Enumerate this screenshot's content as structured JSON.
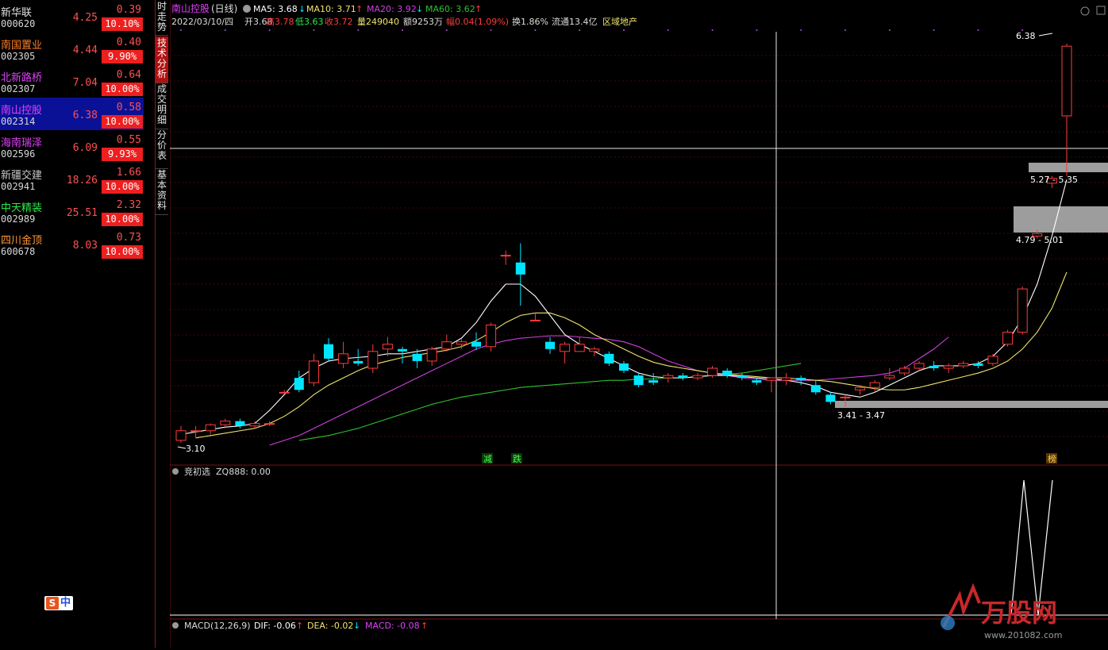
{
  "watchlist": [
    {
      "name": "新华联",
      "code": "000620",
      "price": "4.25",
      "change": "0.39",
      "pct": "10.10%",
      "name_color": "#e0e0e0"
    },
    {
      "name": "南国置业",
      "code": "002305",
      "price": "4.44",
      "change": "0.40",
      "pct": "9.90%",
      "name_color": "#ff7f27"
    },
    {
      "name": "北新路桥",
      "code": "002307",
      "price": "7.04",
      "change": "0.64",
      "pct": "10.00%",
      "name_color": "#e040fb"
    },
    {
      "name": "南山控股",
      "code": "002314",
      "price": "6.38",
      "change": "0.58",
      "pct": "10.00%",
      "name_color": "#e040fb",
      "selected": true
    },
    {
      "name": "海南瑞泽",
      "code": "002596",
      "price": "6.09",
      "change": "0.55",
      "pct": "9.93%",
      "name_color": "#e040fb"
    },
    {
      "name": "新疆交建",
      "code": "002941",
      "price": "18.26",
      "change": "1.66",
      "pct": "10.00%",
      "name_color": "#c8c8c8"
    },
    {
      "name": "中天精装",
      "code": "002989",
      "price": "25.51",
      "change": "2.32",
      "pct": "10.00%",
      "name_color": "#2ee84a"
    },
    {
      "name": "四川金顶",
      "code": "600678",
      "price": "8.03",
      "change": "0.73",
      "pct": "10.00%",
      "name_color": "#ff9a3c"
    }
  ],
  "side_tabs": [
    "时走势",
    "技术分析",
    "成交明细",
    "分价表",
    "基本资料"
  ],
  "header": {
    "stock_name": "南山控股",
    "period": "(日线)",
    "ma5": "MA5: 3.68",
    "ma5_arrow": "↓",
    "ma10": "MA10: 3.71",
    "ma10_arrow": "↑",
    "ma20": "MA20: 3.92",
    "ma20_arrow": "↓",
    "ma60": "MA60: 3.62",
    "ma60_arrow": "↑",
    "line2": {
      "date": "2022/03/10/四",
      "open": "开3.68",
      "high": "高3.78",
      "low": "低3.63",
      "close": "收3.72",
      "vol": "量249040",
      "amount": "额9253万",
      "amp": "幅0.04(1.09%)",
      "turnover": "换1.86%",
      "float": "流通13.4亿",
      "sector": "区域地产"
    }
  },
  "price_labels": {
    "high_marker": "6.38",
    "zone1": "5.27 - 5.35",
    "zone2": "4.79 - 5.01",
    "zone3": "3.41 - 3.47",
    "low_marker": "3.10",
    "tag_reduce": "减",
    "tag_fall": "跌",
    "tag_rank": "榜"
  },
  "indicator1": {
    "title": "竞初选",
    "value": "ZQ888: 0.00"
  },
  "indicator2": {
    "title": "MACD(12,26,9)",
    "dif": "DIF: -0.06",
    "dif_arrow": "↑",
    "dea": "DEA: -0.02",
    "dea_arrow": "↓",
    "macd": "MACD: -0.08",
    "macd_arrow": "↑"
  },
  "brand_badge": {
    "s": "S",
    "zh": "中"
  },
  "watermark": {
    "name": "万股网",
    "url": "www.201082.com"
  },
  "colors": {
    "up": "#ff3b3b",
    "down": "#00e5ff",
    "ma5": "#ffffff",
    "ma10": "#f0e46c",
    "ma20": "#d040e0",
    "ma60": "#2ec22e",
    "accent_red": "#ee1f1f",
    "select_bg": "#0a1196"
  },
  "chart_data": {
    "type": "candlestick",
    "ylim": [
      3.0,
      6.5
    ],
    "candles": [
      {
        "o": 3.1,
        "h": 3.22,
        "l": 3.08,
        "c": 3.18
      },
      {
        "o": 3.18,
        "h": 3.22,
        "l": 3.12,
        "c": 3.18
      },
      {
        "o": 3.18,
        "h": 3.24,
        "l": 3.15,
        "c": 3.23
      },
      {
        "o": 3.23,
        "h": 3.28,
        "l": 3.2,
        "c": 3.26
      },
      {
        "o": 3.26,
        "h": 3.28,
        "l": 3.2,
        "c": 3.22
      },
      {
        "o": 3.22,
        "h": 3.26,
        "l": 3.2,
        "c": 3.24
      },
      {
        "o": 3.24,
        "h": 3.26,
        "l": 3.22,
        "c": 3.24
      },
      {
        "o": 3.5,
        "h": 3.52,
        "l": 3.5,
        "c": 3.5
      },
      {
        "o": 3.62,
        "h": 3.68,
        "l": 3.5,
        "c": 3.52
      },
      {
        "o": 3.58,
        "h": 3.82,
        "l": 3.55,
        "c": 3.76
      },
      {
        "o": 3.9,
        "h": 3.95,
        "l": 3.76,
        "c": 3.78
      },
      {
        "o": 3.74,
        "h": 3.92,
        "l": 3.7,
        "c": 3.82
      },
      {
        "o": 3.76,
        "h": 3.86,
        "l": 3.72,
        "c": 3.74
      },
      {
        "o": 3.7,
        "h": 3.9,
        "l": 3.66,
        "c": 3.84
      },
      {
        "o": 3.86,
        "h": 3.96,
        "l": 3.8,
        "c": 3.9
      },
      {
        "o": 3.86,
        "h": 3.88,
        "l": 3.74,
        "c": 3.84
      },
      {
        "o": 3.82,
        "h": 3.86,
        "l": 3.7,
        "c": 3.76
      },
      {
        "o": 3.76,
        "h": 3.88,
        "l": 3.72,
        "c": 3.86
      },
      {
        "o": 3.86,
        "h": 3.98,
        "l": 3.84,
        "c": 3.92
      },
      {
        "o": 3.9,
        "h": 3.94,
        "l": 3.86,
        "c": 3.92
      },
      {
        "o": 3.92,
        "h": 4.0,
        "l": 3.85,
        "c": 3.88
      },
      {
        "o": 3.88,
        "h": 4.08,
        "l": 3.84,
        "c": 4.06
      },
      {
        "o": 4.64,
        "h": 4.68,
        "l": 4.56,
        "c": 4.64
      },
      {
        "o": 4.58,
        "h": 4.74,
        "l": 4.22,
        "c": 4.48
      },
      {
        "o": 4.1,
        "h": 4.16,
        "l": 4.1,
        "c": 4.1
      },
      {
        "o": 3.92,
        "h": 3.96,
        "l": 3.82,
        "c": 3.86
      },
      {
        "o": 3.84,
        "h": 3.92,
        "l": 3.74,
        "c": 3.9
      },
      {
        "o": 3.84,
        "h": 3.96,
        "l": 3.84,
        "c": 3.9
      },
      {
        "o": 3.84,
        "h": 3.88,
        "l": 3.8,
        "c": 3.86
      },
      {
        "o": 3.82,
        "h": 3.84,
        "l": 3.72,
        "c": 3.74
      },
      {
        "o": 3.74,
        "h": 3.76,
        "l": 3.66,
        "c": 3.68
      },
      {
        "o": 3.64,
        "h": 3.66,
        "l": 3.54,
        "c": 3.56
      },
      {
        "o": 3.6,
        "h": 3.66,
        "l": 3.56,
        "c": 3.58
      },
      {
        "o": 3.62,
        "h": 3.66,
        "l": 3.58,
        "c": 3.64
      },
      {
        "o": 3.64,
        "h": 3.66,
        "l": 3.6,
        "c": 3.62
      },
      {
        "o": 3.62,
        "h": 3.66,
        "l": 3.6,
        "c": 3.64
      },
      {
        "o": 3.64,
        "h": 3.72,
        "l": 3.62,
        "c": 3.7
      },
      {
        "o": 3.68,
        "h": 3.7,
        "l": 3.62,
        "c": 3.64
      },
      {
        "o": 3.64,
        "h": 3.66,
        "l": 3.6,
        "c": 3.62
      },
      {
        "o": 3.6,
        "h": 3.62,
        "l": 3.56,
        "c": 3.58
      },
      {
        "o": 3.6,
        "h": 3.62,
        "l": 3.5,
        "c": 3.62
      },
      {
        "o": 3.6,
        "h": 3.66,
        "l": 3.56,
        "c": 3.62
      },
      {
        "o": 3.62,
        "h": 3.64,
        "l": 3.56,
        "c": 3.6
      },
      {
        "o": 3.56,
        "h": 3.6,
        "l": 3.48,
        "c": 3.5
      },
      {
        "o": 3.48,
        "h": 3.5,
        "l": 3.4,
        "c": 3.42
      },
      {
        "o": 3.46,
        "h": 3.48,
        "l": 3.38,
        "c": 3.46
      },
      {
        "o": 3.52,
        "h": 3.56,
        "l": 3.48,
        "c": 3.54
      },
      {
        "o": 3.54,
        "h": 3.6,
        "l": 3.5,
        "c": 3.58
      },
      {
        "o": 3.62,
        "h": 3.7,
        "l": 3.6,
        "c": 3.64
      },
      {
        "o": 3.66,
        "h": 3.72,
        "l": 3.64,
        "c": 3.7
      },
      {
        "o": 3.7,
        "h": 3.76,
        "l": 3.68,
        "c": 3.74
      },
      {
        "o": 3.72,
        "h": 3.76,
        "l": 3.68,
        "c": 3.7
      },
      {
        "o": 3.7,
        "h": 3.74,
        "l": 3.66,
        "c": 3.72
      },
      {
        "o": 3.72,
        "h": 3.76,
        "l": 3.7,
        "c": 3.74
      },
      {
        "o": 3.74,
        "h": 3.76,
        "l": 3.7,
        "c": 3.72
      },
      {
        "o": 3.74,
        "h": 3.82,
        "l": 3.72,
        "c": 3.8
      },
      {
        "o": 3.9,
        "h": 4.02,
        "l": 3.88,
        "c": 4.0
      },
      {
        "o": 4.0,
        "h": 4.38,
        "l": 3.98,
        "c": 4.36
      },
      {
        "o": 4.8,
        "h": 4.85,
        "l": 4.78,
        "c": 4.82
      },
      {
        "o": 5.24,
        "h": 5.3,
        "l": 5.2,
        "c": 5.28
      },
      {
        "o": 5.8,
        "h": 6.4,
        "l": 5.3,
        "c": 6.38
      }
    ],
    "ma5": [
      3.15,
      3.17,
      3.19,
      3.21,
      3.22,
      3.24,
      3.35,
      3.48,
      3.62,
      3.7,
      3.76,
      3.78,
      3.79,
      3.8,
      3.82,
      3.82,
      3.84,
      3.86,
      3.88,
      3.95,
      4.08,
      4.26,
      4.4,
      4.4,
      4.3,
      4.14,
      3.98,
      3.9,
      3.84,
      3.78,
      3.72,
      3.66,
      3.63,
      3.62,
      3.62,
      3.63,
      3.64,
      3.64,
      3.63,
      3.62,
      3.61,
      3.6,
      3.58,
      3.55,
      3.5,
      3.48,
      3.46,
      3.5,
      3.56,
      3.62,
      3.68,
      3.72,
      3.72,
      3.72,
      3.74,
      3.8,
      3.92,
      4.12,
      4.4,
      4.8,
      5.27
    ],
    "ma10": [
      3.12,
      3.14,
      3.16,
      3.18,
      3.2,
      3.24,
      3.3,
      3.38,
      3.48,
      3.56,
      3.62,
      3.68,
      3.73,
      3.76,
      3.79,
      3.81,
      3.83,
      3.85,
      3.88,
      3.93,
      4.0,
      4.08,
      4.14,
      4.16,
      4.16,
      4.12,
      4.06,
      3.98,
      3.92,
      3.86,
      3.8,
      3.75,
      3.72,
      3.7,
      3.68,
      3.66,
      3.65,
      3.64,
      3.63,
      3.62,
      3.62,
      3.61,
      3.6,
      3.59,
      3.57,
      3.55,
      3.53,
      3.52,
      3.52,
      3.54,
      3.57,
      3.6,
      3.63,
      3.66,
      3.7,
      3.76,
      3.86,
      4.0,
      4.2,
      4.5
    ],
    "ma20": [
      3.06,
      3.1,
      3.14,
      3.2,
      3.26,
      3.32,
      3.38,
      3.44,
      3.5,
      3.56,
      3.62,
      3.68,
      3.74,
      3.8,
      3.86,
      3.9,
      3.93,
      3.95,
      3.96,
      3.97,
      3.97,
      3.96,
      3.95,
      3.94,
      3.92,
      3.88,
      3.82,
      3.76,
      3.72,
      3.68,
      3.66,
      3.64,
      3.62,
      3.61,
      3.6,
      3.6,
      3.6,
      3.6,
      3.61,
      3.62,
      3.63,
      3.64,
      3.66,
      3.7,
      3.78,
      3.86,
      3.96
    ],
    "ma60": [
      3.1,
      3.12,
      3.14,
      3.17,
      3.2,
      3.24,
      3.28,
      3.32,
      3.36,
      3.4,
      3.43,
      3.46,
      3.48,
      3.5,
      3.52,
      3.54,
      3.55,
      3.56,
      3.57,
      3.58,
      3.59,
      3.6,
      3.6,
      3.61,
      3.61,
      3.62,
      3.62,
      3.63,
      3.64,
      3.65,
      3.66,
      3.68,
      3.7,
      3.72,
      3.74
    ]
  }
}
